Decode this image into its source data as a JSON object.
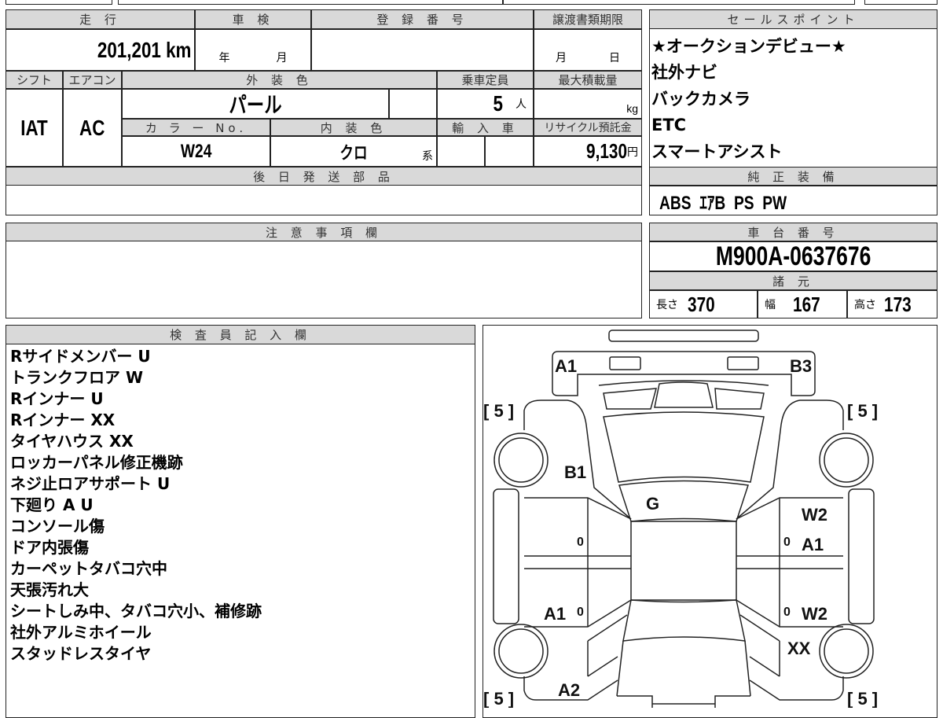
{
  "vehicle": {
    "mileage_label": "走 行",
    "mileage_value": "201,201",
    "mileage_unit": "km",
    "inspection_label": "車 検",
    "inspection_year": "年",
    "inspection_month": "月",
    "registration_label": "登 録 番 号",
    "transfer_label": "譲渡書類期限",
    "transfer_month": "月",
    "transfer_day": "日",
    "shift_label": "シフト",
    "shift_value": "IAT",
    "ac_label": "エアコン",
    "ac_value": "AC",
    "exterior_label": "外 装 色",
    "exterior_value": "パール",
    "capacity_label": "乗車定員",
    "capacity_value": "5",
    "capacity_unit": "人",
    "maxload_label": "最大積載量",
    "maxload_unit": "kg",
    "color_no_label": "カ ラ ー No.",
    "color_no_value": "W24",
    "interior_label": "内 装 色",
    "interior_value": "クロ",
    "interior_unit": "系",
    "import_label": "輸 入 車",
    "recycle_label": "リサイクル預託金",
    "recycle_value": "9,130",
    "recycle_unit": "円",
    "parts_label": "後 日 発 送 部 品"
  },
  "sales_points": {
    "label": "セールスポイント",
    "items": [
      "★オークションデビュー★",
      "社外ナビ",
      "バックカメラ",
      "ETC",
      "スマートアシスト"
    ]
  },
  "equipment": {
    "label": "純 正 装 備",
    "value": "ABS  ｴｱB  PS  PW"
  },
  "caution": {
    "label": "注 意 事 項 欄"
  },
  "chassis": {
    "label": "車 台 番 号",
    "value": "M900A-0637676",
    "specs_label": "諸 元",
    "length_label": "長さ",
    "length": "370",
    "width_label": "幅",
    "width": "167",
    "height_label": "高さ",
    "height": "173"
  },
  "inspector": {
    "label": "検 査 員 記 入 欄",
    "notes": [
      "Rサイドメンバー U",
      "トランクフロア W",
      "Rインナー U",
      "Rインナー XX",
      "タイヤハウス XX",
      "ロッカーパネル修正機跡",
      "ネジ止ロアサポート U",
      "下廻り A U",
      "コンソール傷",
      "ドア内張傷",
      "カーペットタバコ穴中",
      "天張汚れ大",
      "シートしみ中、タバコ穴小、補修跡",
      "社外アルミホイール",
      "スタッドレスタイヤ"
    ]
  },
  "diagram": {
    "tire_tl": "[ 5 ]",
    "tire_tr": "[ 5 ]",
    "tire_bl": "[ 5 ]",
    "tire_br": "[ 5 ]",
    "rear_left": "A1",
    "rear_right": "B3",
    "left_rear_quarter": "B1",
    "rear_glass": "G",
    "right_rear_door_1": "W2",
    "right_rear_door_2": "A1",
    "left_front_door": "A1",
    "right_front_door": "W2",
    "right_front_fender": "XX",
    "left_front_fender": "A2",
    "m1": "0",
    "m2": "0",
    "m3": "0",
    "m4": "0"
  }
}
